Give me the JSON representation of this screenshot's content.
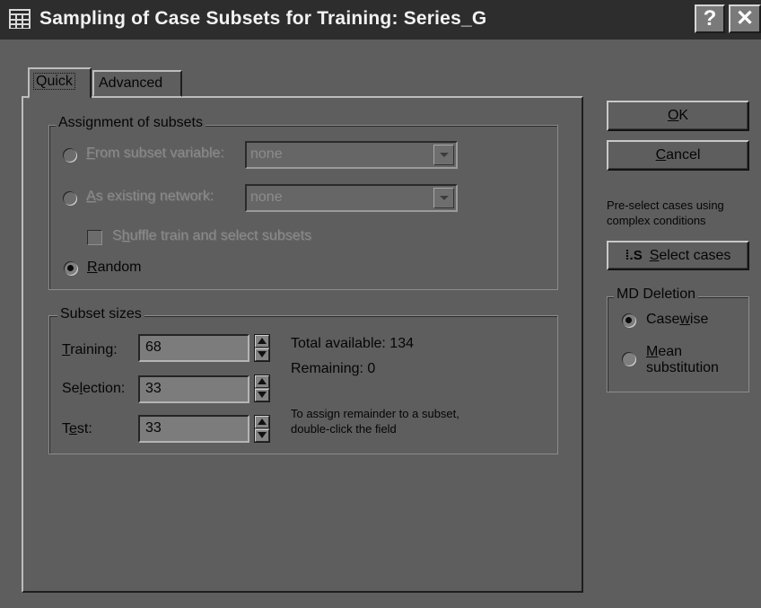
{
  "window": {
    "title": "Sampling of Case Subsets for Training: Series_G",
    "help_glyph": "?",
    "close_glyph": "✕"
  },
  "tabs": [
    {
      "label": "Quick",
      "active": true
    },
    {
      "label": "Advanced",
      "active": false
    }
  ],
  "assignment": {
    "title": "Assignment of subsets",
    "from_subset_variable": {
      "label_pre": "",
      "label_u": "F",
      "label_post": "rom subset variable:",
      "value": "none",
      "checked": false,
      "enabled": false
    },
    "as_existing_network": {
      "label_pre": "",
      "label_u": "A",
      "label_post": "s existing network:",
      "value": "none",
      "checked": false,
      "enabled": false
    },
    "shuffle": {
      "label_pre": "S",
      "label_u": "h",
      "label_post": "uffle train and select subsets",
      "checked": false,
      "enabled": false
    },
    "random": {
      "label_pre": "",
      "label_u": "R",
      "label_post": "andom",
      "checked": true
    }
  },
  "subset_sizes": {
    "title": "Subset sizes",
    "training": {
      "label_pre": "",
      "label_u": "T",
      "label_post": "raining:",
      "value": "68"
    },
    "selection": {
      "label_pre": "Se",
      "label_u": "l",
      "label_post": "ection:",
      "value": "33"
    },
    "test": {
      "label_pre": "T",
      "label_u": "e",
      "label_post": "st:",
      "value": "33"
    },
    "total_available": "Total available:  134",
    "remaining": "Remaining:  0",
    "hint_line1": "To assign remainder to a subset,",
    "hint_line2": "double-click the field"
  },
  "buttons": {
    "ok": {
      "pre": "",
      "u": "O",
      "post": "K"
    },
    "cancel": {
      "pre": "",
      "u": "C",
      "post": "ancel"
    },
    "preselect_line1": "Pre-select cases using",
    "preselect_line2": "complex conditions",
    "select_cases": {
      "icon": "select-cases-icon",
      "glyph": "⁞.S",
      "pre": "",
      "u": "S",
      "post": "elect cases"
    }
  },
  "md_deletion": {
    "title": "MD Deletion",
    "casewise": {
      "pre": "Case",
      "u": "w",
      "post": "ise",
      "checked": true
    },
    "mean": {
      "pre": "",
      "u": "M",
      "post": "ean",
      "line2": "substitution",
      "checked": false
    }
  }
}
